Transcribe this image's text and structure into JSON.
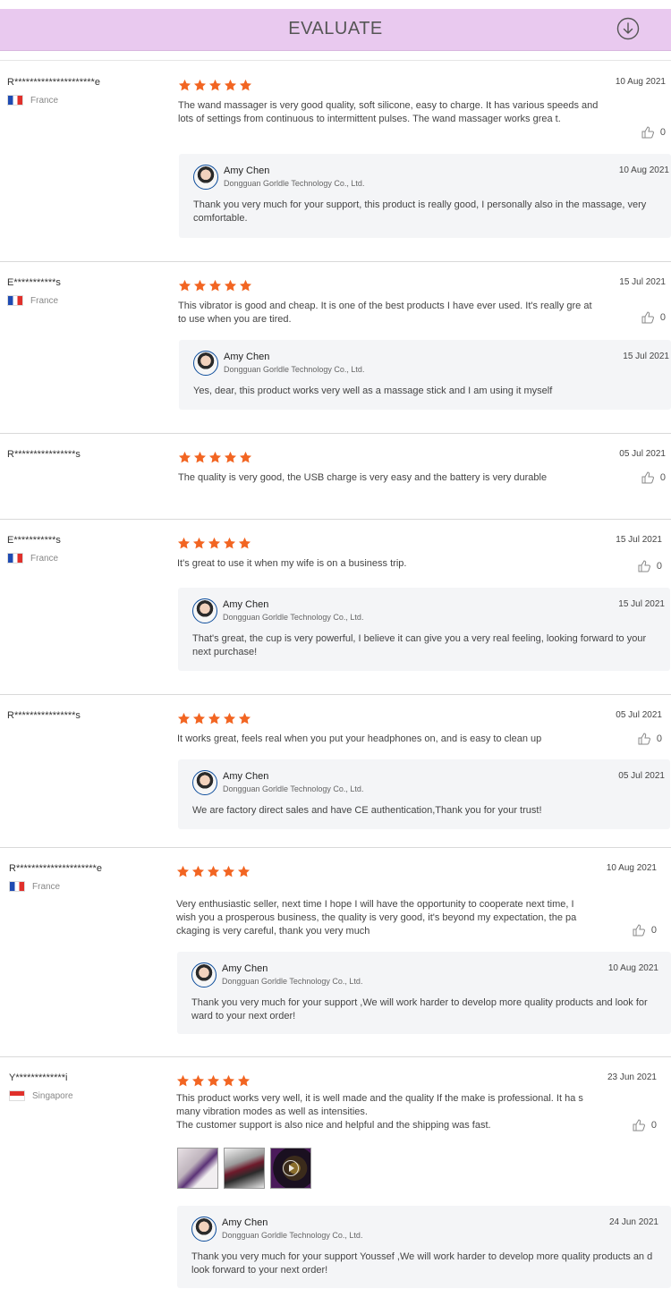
{
  "header": {
    "title": "EVALUATE",
    "icon": "download-icon",
    "bg_color": "#e9c9ef"
  },
  "colors": {
    "star": "#f26522"
  },
  "reviews": [
    {
      "user": "R*********************e",
      "country": "France",
      "flag": "fr",
      "stars": 5,
      "date": "10 Aug 2021",
      "text": "The wand massager is very good quality, soft silicone, easy to charge. It has various speeds and lots of settings from continuous to intermittent pulses. The wand massager works grea t.",
      "likes": "0",
      "reply": {
        "name": "Amy Chen",
        "company": "Dongguan Gorldle Technology Co., Ltd.",
        "date": "10 Aug 2021",
        "text": "Thank you very much for your support, this product is really good, I personally also in the massage, very comfortable."
      }
    },
    {
      "user": "E***********s",
      "country": "France",
      "flag": "fr",
      "stars": 5,
      "date": "15 Jul 2021",
      "text": "This vibrator is good and cheap. It is one of the best products I have ever used. It's really gre at to use when you are tired.",
      "likes": "0",
      "reply": {
        "name": "Amy Chen",
        "company": "Dongguan Gorldle Technology Co., Ltd.",
        "date": "15 Jul 2021",
        "text": "Yes, dear, this product works very well as a massage stick and I am using it myself"
      }
    },
    {
      "user": "R****************s",
      "country": "",
      "flag": "",
      "stars": 5,
      "date": "05 Jul 2021",
      "text": "The quality is very good, the USB charge is very easy and the battery is very durable",
      "likes": "0",
      "reply": null
    },
    {
      "user": "E***********s",
      "country": "France",
      "flag": "fr",
      "stars": 5,
      "date": "15 Jul 2021",
      "text": "It's great to use it when my wife is on a business trip.",
      "likes": "0",
      "reply": {
        "name": "Amy Chen",
        "company": "Dongguan Gorldle Technology Co., Ltd.",
        "date": "15 Jul 2021",
        "text": "That's great, the cup is very powerful, I believe it can give you a very real feeling, looking forward to your next purchase!"
      }
    },
    {
      "user": "R****************s",
      "country": "",
      "flag": "",
      "stars": 5,
      "date": "05 Jul 2021",
      "text": "It works great, feels real when you put your headphones on, and is easy to clean up",
      "likes": "0",
      "reply": {
        "name": "Amy Chen",
        "company": "Dongguan Gorldle Technology Co., Ltd.",
        "date": "05 Jul 2021",
        "text": "We are factory direct sales and have CE authentication,Thank you for your trust!"
      }
    },
    {
      "user": "R*********************e",
      "country": "France",
      "flag": "fr",
      "stars": 5,
      "date": "10 Aug 2021",
      "text": "Very enthusiastic seller, next time I hope I will have the opportunity to cooperate next time, I wish you a prosperous business, the quality is very good, it's beyond my expectation, the pa ckaging is very careful, thank you very much",
      "likes": "0",
      "reply": {
        "name": "Amy Chen",
        "company": "Dongguan Gorldle Technology Co., Ltd.",
        "date": "10 Aug 2021",
        "text": "Thank you very much for your support ,We will work harder to develop more quality products and look for ward to your next order!"
      }
    },
    {
      "user": "Y*************i",
      "country": "Singapore",
      "flag": "sg",
      "stars": 5,
      "date": "23 Jun 2021",
      "text": "This product works very well, it is well made and the quality If the make is professional. It ha s many vibration modes as well as intensities.\nThe customer support is also nice and helpful and the shipping was fast.",
      "likes": "0",
      "photos": 3,
      "reply": {
        "name": "Amy Chen",
        "company": "Dongguan Gorldle Technology Co., Ltd.",
        "date": "24 Jun 2021",
        "text": "Thank you very much for your support Youssef ,We will work harder to develop more quality products an d look forward to your next order!"
      }
    }
  ]
}
